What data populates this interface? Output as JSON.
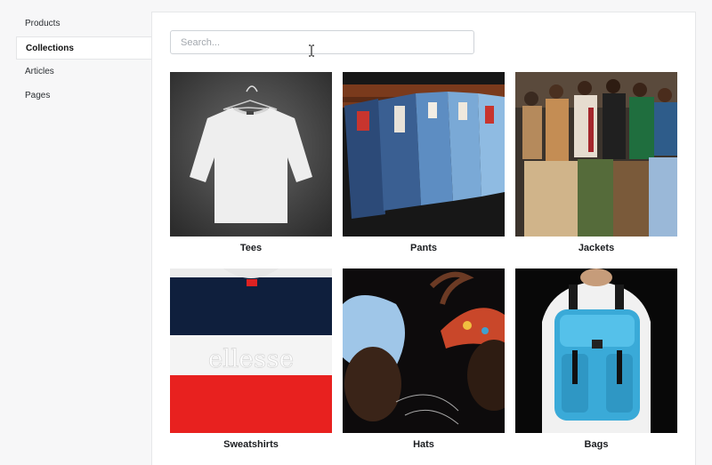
{
  "sidebar": {
    "items": [
      {
        "label": "Products"
      },
      {
        "label": "Collections"
      },
      {
        "label": "Articles"
      },
      {
        "label": "Pages"
      }
    ]
  },
  "search": {
    "placeholder": "Search...",
    "value": ""
  },
  "collections": [
    {
      "label": "Tees"
    },
    {
      "label": "Pants"
    },
    {
      "label": "Jackets"
    },
    {
      "label": "Sweatshirts"
    },
    {
      "label": "Hats"
    },
    {
      "label": "Bags"
    }
  ],
  "images": {
    "sweatshirt_logo": "ellesse"
  },
  "colors": {
    "active_bg": "#ffffff",
    "border": "#e4e5e7",
    "page_bg": "#f7f7f8"
  }
}
